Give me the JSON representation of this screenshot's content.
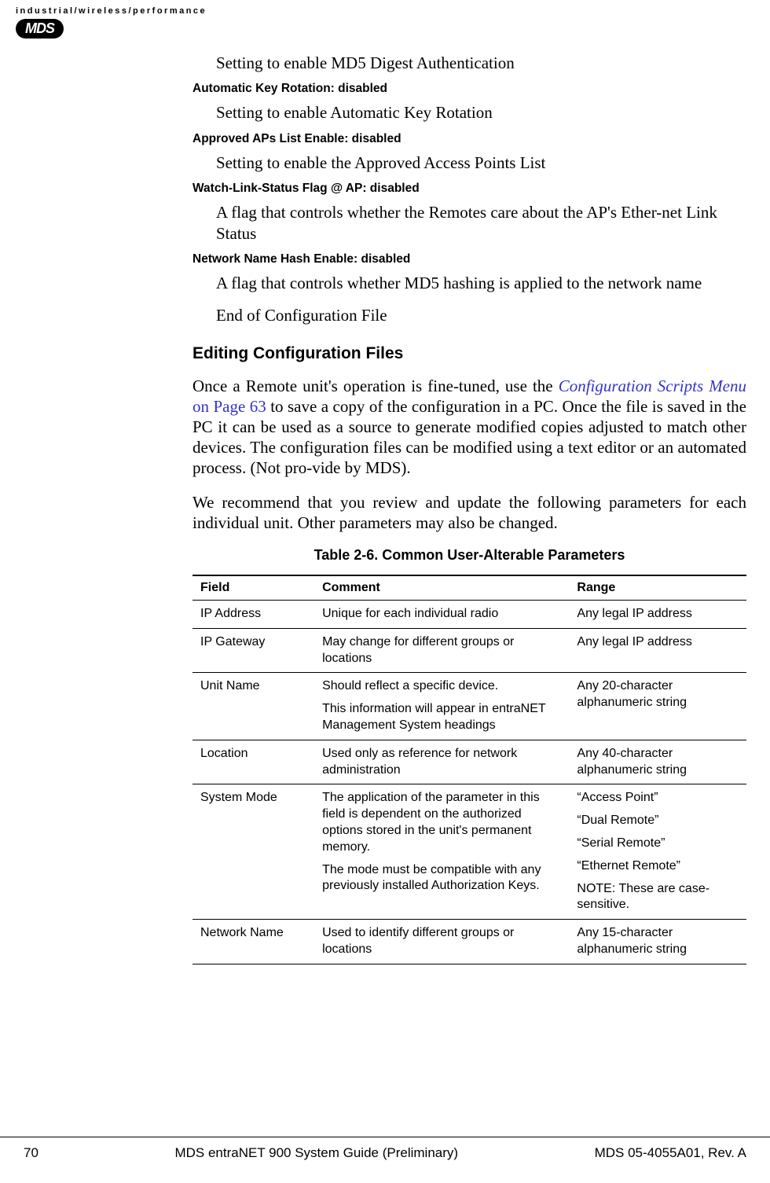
{
  "header": {
    "tagline": "industrial/wireless/performance",
    "logo": "MDS"
  },
  "config_items": [
    {
      "desc": "Setting to enable MD5 Digest Authentication",
      "label": "Automatic Key Rotation: disabled"
    },
    {
      "desc": "Setting to enable Automatic Key Rotation",
      "label": "Approved APs List Enable: disabled"
    },
    {
      "desc": "Setting to enable the Approved Access Points List",
      "label": "Watch-Link-Status Flag @ AP: disabled"
    },
    {
      "desc": "A flag that controls whether the Remotes care about the AP's Ether-net Link Status",
      "label": "Network Name Hash Enable: disabled"
    },
    {
      "desc": "A flag that controls whether MD5 hashing is applied to the network name",
      "label": ""
    }
  ],
  "end_file": "End of Configuration File",
  "section_heading": "Editing Configuration Files",
  "para1_pre": "Once a Remote unit's operation is fine-tuned, use the ",
  "para1_link_text": "Configuration Scripts Menu",
  "para1_link_page": " on Page 63",
  "para1_post": " to save a copy of the configuration in a PC. Once the file is saved in the PC it can be used as a source to generate modified copies adjusted to match other devices. The configuration files can be modified using a text editor or an automated process. (Not pro-vide by MDS).",
  "para2": "We recommend that you review and update the following parameters for each individual unit. Other parameters may also be changed.",
  "table": {
    "caption": "Table 2-6. Common User-Alterable Parameters",
    "headers": {
      "field": "Field",
      "comment": "Comment",
      "range": "Range"
    },
    "rows": [
      {
        "field": "IP Address",
        "comment": [
          "Unique for each individual radio"
        ],
        "range": [
          "Any legal IP address"
        ]
      },
      {
        "field": "IP Gateway",
        "comment": [
          "May change for different groups or locations"
        ],
        "range": [
          "Any legal IP address"
        ]
      },
      {
        "field": "Unit Name",
        "comment": [
          "Should reflect a specific device.",
          "This information will appear in entraNET Management System headings"
        ],
        "range": [
          "Any 20-character alphanumeric string"
        ]
      },
      {
        "field": "Location",
        "comment": [
          "Used only as reference for network administration"
        ],
        "range": [
          "Any 40-character alphanumeric string"
        ]
      },
      {
        "field": "System Mode",
        "comment": [
          "The application of the parameter in this field is dependent on the authorized options stored in the unit's permanent memory.",
          "The mode must be compatible with any previously installed Authorization Keys."
        ],
        "range": [
          "“Access Point”",
          "“Dual Remote”",
          "“Serial Remote”",
          "“Ethernet Remote”",
          "NOTE: These are case-sensitive."
        ]
      },
      {
        "field": "Network Name",
        "comment": [
          "Used to identify different groups or locations"
        ],
        "range": [
          "Any 15-character alphanumeric string"
        ]
      }
    ]
  },
  "footer": {
    "page": "70",
    "title": "MDS entraNET 900 System Guide (Preliminary)",
    "docnum": "MDS 05-4055A01, Rev. A"
  }
}
